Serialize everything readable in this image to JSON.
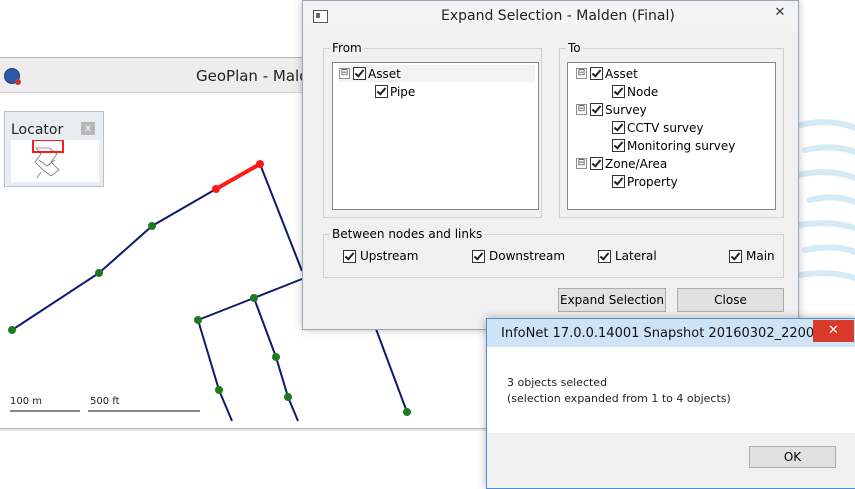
{
  "geoplan": {
    "title": "GeoPlan - Malde",
    "locator": {
      "title": "Locator",
      "close": "x"
    },
    "scale": {
      "metric": "100 m",
      "imperial": "500 ft"
    }
  },
  "dialog": {
    "title": "Expand Selection - Malden (Final)",
    "close": "✕",
    "from": {
      "label": "From",
      "items": [
        {
          "label": "Asset",
          "expander": "⊟"
        },
        {
          "label": "Pipe"
        }
      ]
    },
    "to": {
      "label": "To",
      "items": [
        {
          "label": "Asset",
          "expander": "⊟"
        },
        {
          "label": "Node"
        },
        {
          "label": "Survey",
          "expander": "⊟"
        },
        {
          "label": "CCTV survey"
        },
        {
          "label": "Monitoring survey"
        },
        {
          "label": "Zone/Area",
          "expander": "⊟"
        },
        {
          "label": "Property"
        }
      ]
    },
    "between": {
      "label": "Between nodes and links",
      "options": [
        "Upstream",
        "Downstream",
        "Lateral",
        "Main"
      ]
    },
    "buttons": {
      "expand": "Expand Selection",
      "close": "Close"
    }
  },
  "message": {
    "title": "InfoNet 17.0.0.14001 Snapshot 20160302_2200",
    "close": "✕",
    "line1": "3 objects selected",
    "line2": "(selection expanded from 1 to 4 objects)",
    "ok": "OK"
  },
  "colors": {
    "pipe": "#0d1a6e",
    "selected_pipe": "#ff1a1a",
    "node": "#1e7a1e"
  }
}
